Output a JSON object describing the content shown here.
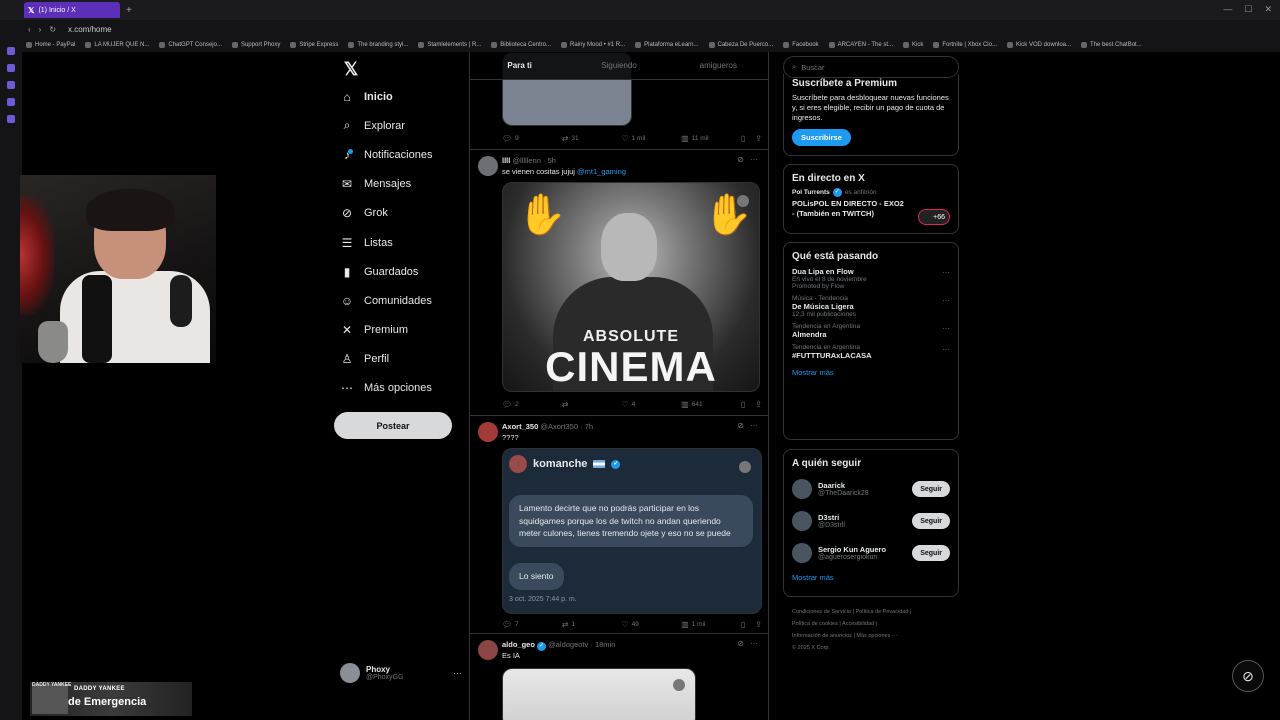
{
  "browser": {
    "tab_title": "(1) Inicio / X",
    "url": "x.com/home",
    "bookmarks": [
      "Home - PayPal",
      "LA MUJER QUE N...",
      "ChatGPT Consejo...",
      "Support Phoxy",
      "Stripe Express",
      "The branding styl...",
      "Stamlelements | R...",
      "Biblioteca Centro...",
      "Rainy Mood • #1 R...",
      "Plataforma eLearn...",
      "Cabeza De Puerco...",
      "Facebook",
      "ARCAYEN - The st...",
      "Kick",
      "Fortnite | Xbox Clo...",
      "Kick VOD downloa...",
      "The best ChatBot..."
    ]
  },
  "overlay": {
    "tag": "DADDY YANKEE",
    "small": "DADDY YANKEE",
    "big": "de Emergencia"
  },
  "nav": {
    "items": [
      {
        "label": "Inicio",
        "icon": "home-icon",
        "glyph": "⌂"
      },
      {
        "label": "Explorar",
        "icon": "search-icon",
        "glyph": "⌕"
      },
      {
        "label": "Notificaciones",
        "icon": "bell-icon",
        "glyph": "♪"
      },
      {
        "label": "Mensajes",
        "icon": "mail-icon",
        "glyph": "✉"
      },
      {
        "label": "Grok",
        "icon": "grok-icon",
        "glyph": "⊘"
      },
      {
        "label": "Listas",
        "icon": "list-icon",
        "glyph": "☰"
      },
      {
        "label": "Guardados",
        "icon": "bookmark-icon",
        "glyph": "▮"
      },
      {
        "label": "Comunidades",
        "icon": "communities-icon",
        "glyph": "☺"
      },
      {
        "label": "Premium",
        "icon": "x-icon",
        "glyph": "✕"
      },
      {
        "label": "Perfil",
        "icon": "person-icon",
        "glyph": "♙"
      },
      {
        "label": "Más opciones",
        "icon": "more-icon",
        "glyph": "⋯"
      }
    ],
    "post_label": "Postear"
  },
  "profile": {
    "name": "Phoxy",
    "handle": "@PhoxyGG"
  },
  "timeline": {
    "tabs": [
      "Para ti",
      "Siguiendo",
      "amigueros"
    ],
    "tweet0_actions": {
      "reply": "9",
      "repost": "31",
      "like": "1 mil",
      "views": "11 mil"
    },
    "tweet1": {
      "name": "llll",
      "handle": "@lllllenn",
      "time": "· 5h",
      "text": "se vienen cositas jujuj ",
      "mention": "@mt1_gaming",
      "image_line1": "ABSOLUTE",
      "image_line2": "CINEMA",
      "actions": {
        "reply": "2",
        "repost": "",
        "like": "4",
        "views": "641"
      }
    },
    "tweet2": {
      "name": "Axort_350",
      "handle": "@Axort350",
      "time": "· 7h",
      "text": "????",
      "dm_name": "komanche",
      "dm_message": "Lamento decirte que no podrás participar en los squidgames porque los de twitch no andan queriendo meter culones, tienes tremendo ojete y eso no se puede",
      "dm_reply": "Lo siento",
      "dm_time": "3 oct. 2025 7:44 p. m.",
      "actions": {
        "reply": "7",
        "repost": "1",
        "like": "49",
        "views": "1 mil"
      }
    },
    "tweet3": {
      "name": "aldo_geo",
      "handle": "@aldogeotv",
      "time": "· 18min",
      "text": "Es IA"
    }
  },
  "right": {
    "search_placeholder": "Buscar",
    "premium": {
      "title": "Suscríbete a Premium",
      "text": "Suscríbete para desbloquear nuevas funciones y, si eres elegible, recibir un pago de cuota de ingresos.",
      "button": "Suscribirse"
    },
    "live": {
      "title": "En directo en X",
      "host": "Pol Turrents",
      "host_suffix": "es anfitrión",
      "stream_title": "POLisPOL EN DIRECTO - EXO2 - (También en TWITCH)",
      "count": "+66"
    },
    "trends": {
      "title": "Qué está pasando",
      "items": [
        {
          "category": "",
          "title": "Dua Lipa en Flow",
          "sub": "En vivo el 8 de noviembre",
          "sub2": "Promoted by Flow"
        },
        {
          "category": "Música · Tendencia",
          "title": "De Música Ligera",
          "sub": "12,3 mil publicaciones",
          "sub2": ""
        },
        {
          "category": "Tendencia en Argentina",
          "title": "Almendra",
          "sub": "",
          "sub2": ""
        },
        {
          "category": "Tendencia en Argentina",
          "title": "#FUTTTURAxLACASA",
          "sub": "",
          "sub2": ""
        }
      ],
      "show_more": "Mostrar más"
    },
    "who_to_follow": {
      "title": "A quién seguir",
      "items": [
        {
          "name": "Daarick",
          "handle": "@TheDaarick28",
          "button": "Seguir"
        },
        {
          "name": "D3stri",
          "handle": "@D3strll",
          "button": "Seguir"
        },
        {
          "name": "Sergio Kun Aguero",
          "handle": "@aguerosergiokun",
          "button": "Seguir"
        }
      ],
      "show_more": "Mostrar más"
    },
    "footer": {
      "line1": "Condiciones de Servicio  |  Política de Privacidad  |",
      "line2": "Política de cookies  |  Accesibilidad  |",
      "line3": "Información de anuncios  |  Más opciones ···",
      "line4": "© 2025 X Corp."
    }
  }
}
